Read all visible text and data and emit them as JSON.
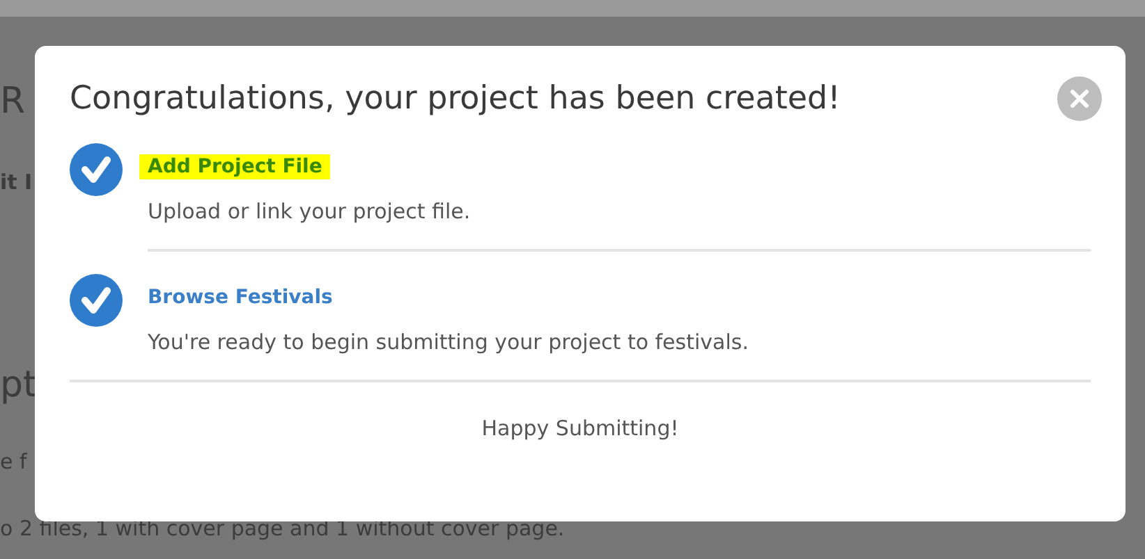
{
  "background_page": {
    "fragments": [
      {
        "kind": "heading",
        "text": "R"
      },
      {
        "kind": "tab",
        "text": "it I"
      },
      {
        "kind": "heading",
        "text": "pt"
      },
      {
        "kind": "body",
        "text": "e f"
      }
    ],
    "footer_text": "o 2 files, 1 with cover page and 1 without cover page."
  },
  "dialog": {
    "title": "Congratulations, your project has been created!",
    "steps": [
      {
        "link": "Add Project File",
        "description": "Upload or link your project file.",
        "checked": true,
        "highlighted": true
      },
      {
        "link": "Browse Festivals",
        "description": "You're ready to begin submitting your project to festivals.",
        "checked": true,
        "highlighted": false
      }
    ],
    "footer": "Happy Submitting!"
  }
}
